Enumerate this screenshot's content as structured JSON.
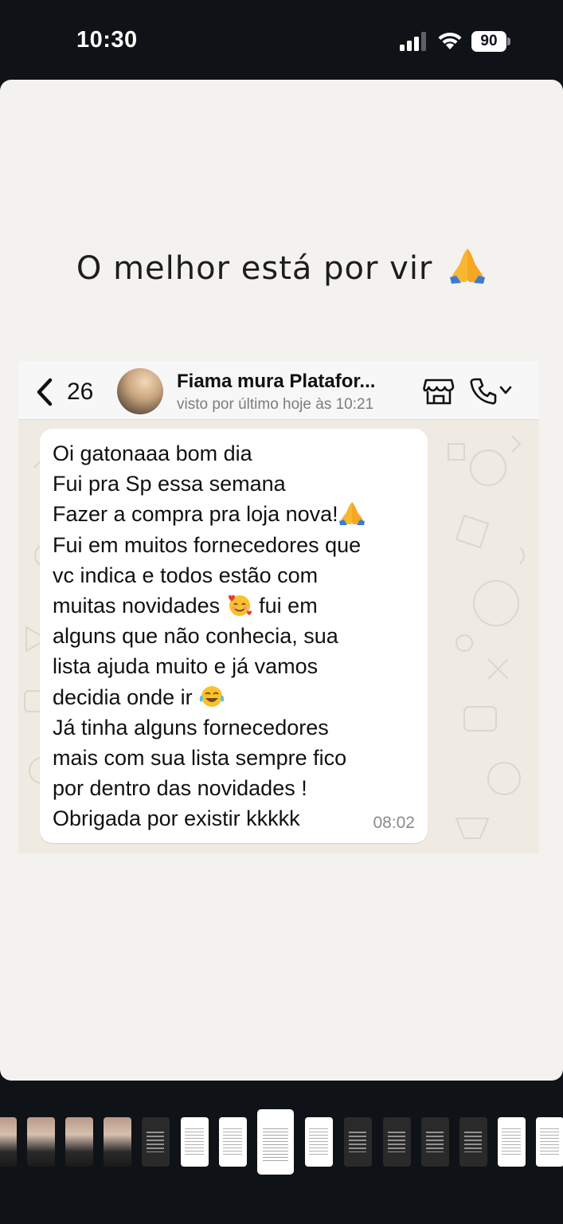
{
  "status_bar": {
    "time": "10:30",
    "battery": "90",
    "icons": [
      "cellular-signal-icon",
      "wifi-icon",
      "battery-icon"
    ]
  },
  "story": {
    "headline": "O melhor está por vir",
    "headline_emoji": "folded-hands-emoji"
  },
  "chat": {
    "header": {
      "unread_count": "26",
      "contact_name": "Fiama mura Platafor...",
      "last_seen": "visto por último hoje às 10:21",
      "icons": [
        "back-chevron-icon",
        "avatar",
        "store-icon",
        "phone-icon",
        "chevron-down-icon"
      ]
    },
    "message": {
      "lines": [
        "Oi gatonaaa bom dia",
        "Fui pra Sp essa semana",
        "Fazer a compra pra loja nova!",
        "Fui em muitos fornecedores que",
        "vc indica e todos estão com",
        "muitas novidades",
        "fui em",
        "alguns que não conhecia, sua",
        "lista ajuda muito e já vamos",
        "decidia onde ir",
        "Já tinha alguns fornecedores",
        "mais com sua lista sempre fico",
        "por dentro das novidades !",
        "Obrigada por existir kkkkk"
      ],
      "emojis": [
        "folded-hands-emoji",
        "smiling-face-with-hearts-emoji",
        "tears-of-joy-emoji"
      ],
      "time": "08:02"
    }
  },
  "thumbnails": {
    "count": 15,
    "active_index": 7
  },
  "colors": {
    "background": "#0f1216",
    "card": "#f3f2ef",
    "chat_bg": "#efeae2",
    "bubble": "#ffffff"
  }
}
